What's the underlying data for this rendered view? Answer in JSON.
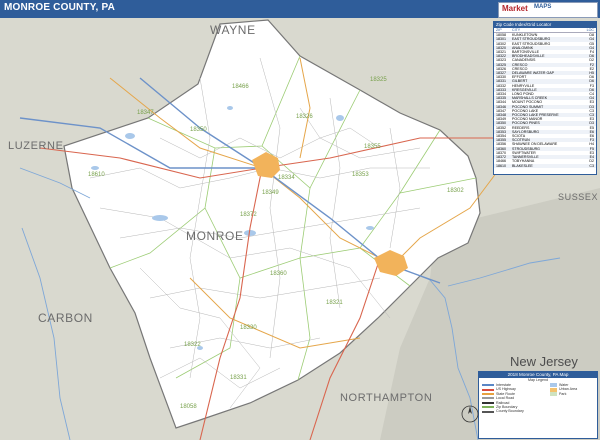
{
  "title": "MONROE COUNTY, PA",
  "logo": {
    "mark": "Market",
    "sub": "MAPS"
  },
  "county_labels": [
    {
      "name": "WAYNE"
    },
    {
      "name": "LUZERNE"
    },
    {
      "name": "MONROE"
    },
    {
      "name": "CARBON"
    },
    {
      "name": "NORTHAMPTON"
    },
    {
      "name": "SUSSEX"
    }
  ],
  "state_label": "New Jersey",
  "zip_labels": [
    "18466",
    "18347",
    "18350",
    "18325",
    "18326",
    "18355",
    "18334",
    "18610",
    "18349",
    "18372",
    "18353",
    "18360",
    "18302",
    "18330",
    "18058",
    "18322",
    "18331",
    "18321"
  ],
  "locator": {
    "title": "Zip Code Index/Grid Locator",
    "columns": [
      "ZIP",
      "CITY",
      "LOC"
    ],
    "rows": [
      [
        "18058",
        "KUNKLETOWN",
        "D8"
      ],
      [
        "18301",
        "EAST STROUDSBURG",
        "G4"
      ],
      [
        "18302",
        "EAST STROUDSBURG",
        "G5"
      ],
      [
        "18320",
        "ANALOMINK",
        "G4"
      ],
      [
        "18321",
        "BARTONSVILLE",
        "F4"
      ],
      [
        "18322",
        "BRODHEADSVILLE",
        "D6"
      ],
      [
        "18323",
        "CANADENSIS",
        "D2"
      ],
      [
        "18325",
        "CRESCO",
        "F2"
      ],
      [
        "18326",
        "CRESCO",
        "E2"
      ],
      [
        "18327",
        "DELAWARE WATER GAP",
        "H5"
      ],
      [
        "18330",
        "EFFORT",
        "D6"
      ],
      [
        "18331",
        "GILBERT",
        "D6"
      ],
      [
        "18332",
        "HENRYVILLE",
        "F3"
      ],
      [
        "18333",
        "KRESGEVILLE",
        "D6"
      ],
      [
        "18334",
        "LONG POND",
        "C4"
      ],
      [
        "18335",
        "MARSHALLS CREEK",
        "G4"
      ],
      [
        "18344",
        "MOUNT POCONO",
        "E3"
      ],
      [
        "18346",
        "POCONO SUMMIT",
        "D3"
      ],
      [
        "18347",
        "POCONO LAKE",
        "C3"
      ],
      [
        "18348",
        "POCONO LAKE PRESERVE",
        "C3"
      ],
      [
        "18349",
        "POCONO MANOR",
        "E3"
      ],
      [
        "18350",
        "POCONO PINES",
        "D3"
      ],
      [
        "18352",
        "REEDERS",
        "E5"
      ],
      [
        "18353",
        "SAYLORSBURG",
        "E6"
      ],
      [
        "18354",
        "SCIOTA",
        "E6"
      ],
      [
        "18355",
        "SCOTRUN",
        "F3"
      ],
      [
        "18356",
        "SHAWNEE ON DELAWARE",
        "H4"
      ],
      [
        "18360",
        "STROUDSBURG",
        "F5"
      ],
      [
        "18370",
        "SWIFTWATER",
        "E3"
      ],
      [
        "18372",
        "TANNERSVILLE",
        "E4"
      ],
      [
        "18466",
        "TOBYHANNA",
        "D2"
      ],
      [
        "18610",
        "BLAKESLEE",
        "C3"
      ]
    ]
  },
  "legend": {
    "title": "2018 Monroe County, PA Map",
    "subtitle": "Map Legend",
    "items": [
      {
        "label": "Interstate",
        "color": "#5a86c5"
      },
      {
        "label": "US Highway",
        "color": "#d94b3d"
      },
      {
        "label": "State Route",
        "color": "#e7a13f"
      },
      {
        "label": "Local Road",
        "color": "#9a9a9a"
      },
      {
        "label": "Railroad",
        "color": "#333333"
      },
      {
        "label": "Zip Boundary",
        "color": "#7fb25a"
      },
      {
        "label": "County Boundary",
        "color": "#555555"
      }
    ],
    "extra": [
      "Water",
      "Urban Area",
      "Park"
    ],
    "colors": {
      "water": "#a9c8ea",
      "urban": "#f4c26d",
      "park": "#cfe3c0"
    }
  },
  "colors": {
    "county_fill": "#ffffff",
    "outside_fill": "#d9d9cf",
    "nj_fill": "#ccccc2",
    "river": "#7ea7d8",
    "zip_boundary": "#9ccc74",
    "local_road": "#b7b7b7",
    "major_road": "#d9664f",
    "state_road": "#e5a64a",
    "county_border": "#777777",
    "interstate": "#6d92c9",
    "urban": "#f2b35b"
  }
}
